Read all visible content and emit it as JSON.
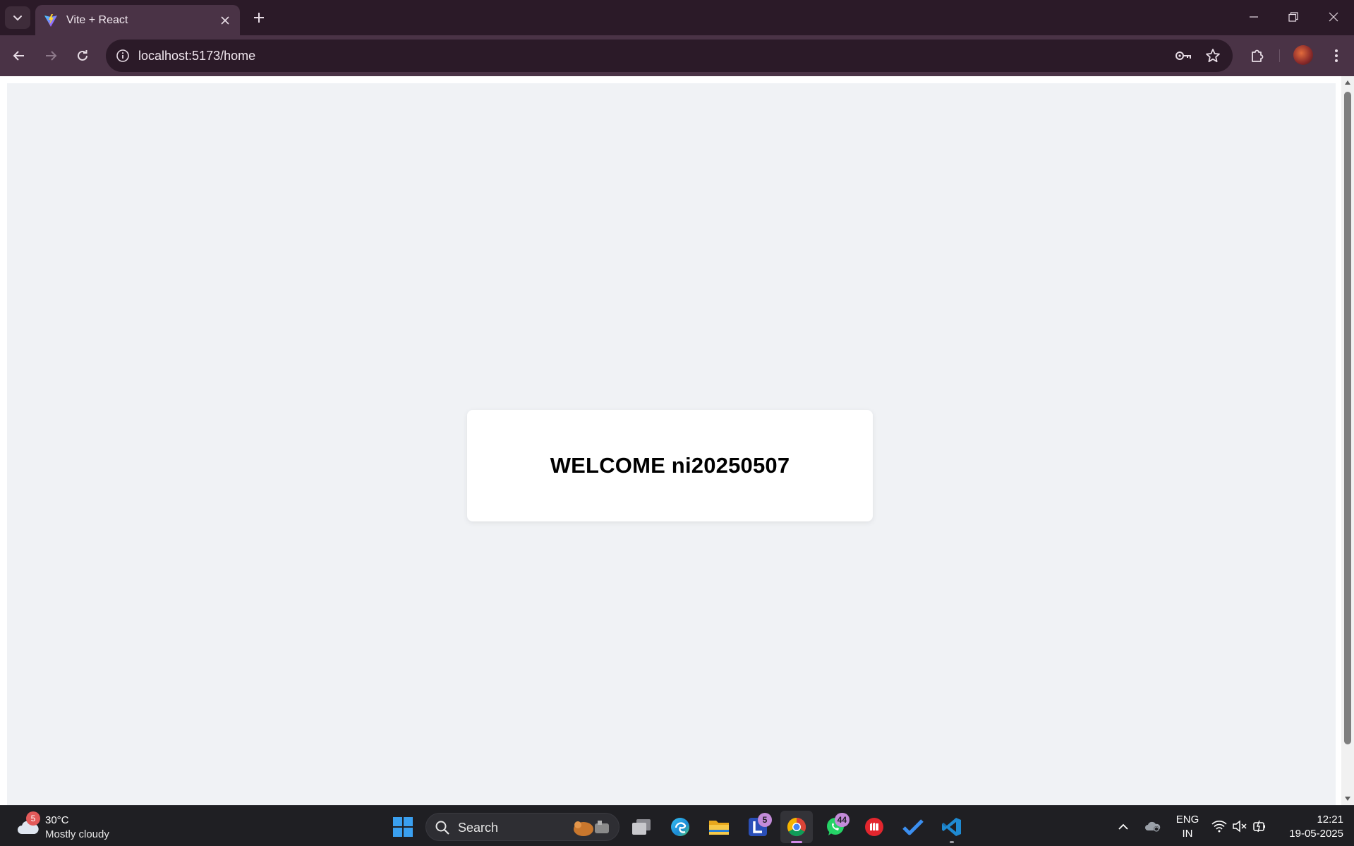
{
  "browser": {
    "tab": {
      "title": "Vite + React"
    },
    "address_bar": {
      "url": "localhost:5173/home"
    }
  },
  "page": {
    "welcome_text": "WELCOME ni20250507"
  },
  "taskbar": {
    "weather": {
      "badge": "5",
      "temperature": "30°C",
      "condition": "Mostly cloudy"
    },
    "search": {
      "label": "Search"
    },
    "apps": [
      {
        "name": "Start",
        "icon": "windows-start-icon"
      },
      {
        "name": "Task view",
        "icon": "task-view-icon"
      },
      {
        "name": "Edge",
        "icon": "edge-icon"
      },
      {
        "name": "File Explorer",
        "icon": "folder-icon"
      },
      {
        "name": "L app",
        "icon": "l-app-icon",
        "badge": "5"
      },
      {
        "name": "Chrome",
        "icon": "chrome-icon",
        "active": true
      },
      {
        "name": "WhatsApp",
        "icon": "whatsapp-icon",
        "badge": "44"
      },
      {
        "name": "Red app",
        "icon": "red-app-icon"
      },
      {
        "name": "To Do",
        "icon": "checkmark-icon"
      },
      {
        "name": "VS Code",
        "icon": "vscode-icon"
      }
    ],
    "language": {
      "line1": "ENG",
      "line2": "IN"
    },
    "clock": {
      "time": "12:21",
      "date": "19-05-2025"
    }
  },
  "colors": {
    "browser_frame": "#2b1a28",
    "toolbar": "#4a3346",
    "page_background": "#f0f2f5",
    "card_background": "#ffffff",
    "taskbar": "#1f1f23",
    "accent": "#d38ae8"
  }
}
